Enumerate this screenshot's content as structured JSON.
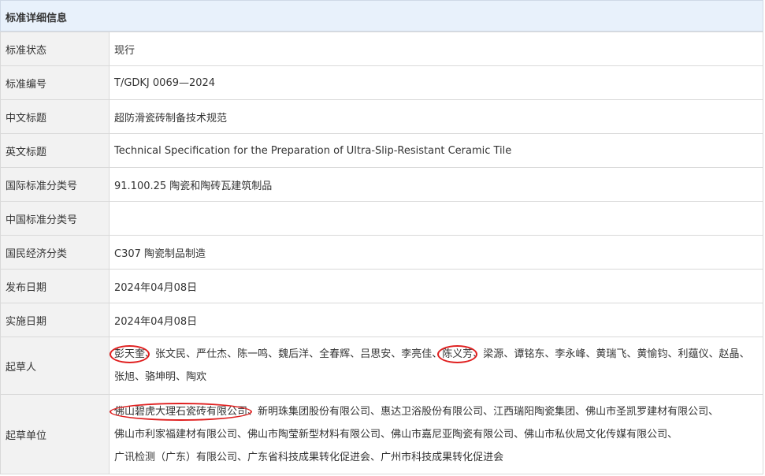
{
  "header": {
    "title": "标准详细信息"
  },
  "rows": [
    {
      "label": "标准状态",
      "value": "现行"
    },
    {
      "label": "标准编号",
      "value": "T/GDKJ 0069—2024"
    },
    {
      "label": "中文标题",
      "value": "超防滑瓷砖制备技术规范"
    },
    {
      "label": "英文标题",
      "value": "Technical Specification for the Preparation of Ultra-Slip-Resistant Ceramic Tile"
    },
    {
      "label": "国际标准分类号",
      "value": "91.100.25 陶瓷和陶砖瓦建筑制品"
    },
    {
      "label": "中国标准分类号",
      "value": ""
    },
    {
      "label": "国民经济分类",
      "value": "C307 陶瓷制品制造"
    },
    {
      "label": "发布日期",
      "value": "2024年04月08日"
    },
    {
      "label": "实施日期",
      "value": "2024年04月08日"
    }
  ],
  "drafters": {
    "label": "起草人",
    "separator": "、",
    "names": [
      "彭天奎",
      "张文民",
      "严仕杰",
      "陈一鸣",
      "魏后洋",
      "全春辉",
      "吕思安",
      "李亮佳",
      "陈义芳",
      "梁源",
      "谭铭东",
      "李永峰",
      "黄瑞飞",
      "黄愉钧",
      "利蕴仪",
      "赵晶",
      "张旭",
      "骆坤明",
      "陶欢"
    ],
    "circled": [
      0,
      8
    ]
  },
  "units": {
    "label": "起草单位",
    "separator": "、",
    "names": [
      "佛山碧虎大理石瓷砖有限公司",
      "新明珠集团股份有限公司",
      "惠达卫浴股份有限公司",
      "江西瑞阳陶瓷集团",
      "佛山市圣凯罗建材有限公司",
      "佛山市利家福建材有限公司",
      "佛山市陶莹新型材料有限公司",
      "佛山市嘉尼亚陶瓷有限公司",
      "佛山市私伙局文化传媒有限公司",
      "广讯检测（广东）有限公司",
      "广东省科技成果转化促进会",
      "广州市科技成果转化促进会"
    ],
    "circled": [
      0
    ]
  },
  "colors": {
    "header_bg": "#e8f1fb",
    "label_bg": "#f2f2f2",
    "border": "#d9d9d9",
    "annotation": "#e02020"
  }
}
